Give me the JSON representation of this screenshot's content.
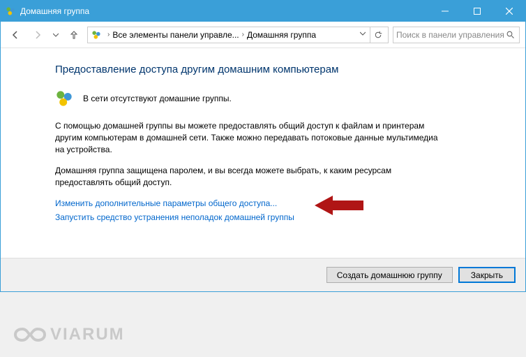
{
  "titlebar": {
    "title": "Домашняя группа"
  },
  "nav": {
    "breadcrumb1": "Все элементы панели управле...",
    "breadcrumb2": "Домашняя группа",
    "search_placeholder": "Поиск в панели управления"
  },
  "content": {
    "heading": "Предоставление доступа другим домашним компьютерам",
    "status": "В сети отсутствуют домашние группы.",
    "para1": "С помощью домашней группы вы можете предоставлять общий доступ к файлам и принтерам другим компьютерам в домашней сети. Также можно передавать потоковые данные мультимедиа на устройства.",
    "para2": "Домашняя группа защищена паролем, и вы всегда можете выбрать, к каким ресурсам предоставлять общий доступ.",
    "link1": "Изменить дополнительные параметры общего доступа...",
    "link2": "Запустить средство устранения неполадок домашней группы"
  },
  "footer": {
    "create_label": "Создать домашнюю группу",
    "close_label": "Закрыть"
  },
  "watermark": {
    "text": "VIARUM"
  }
}
